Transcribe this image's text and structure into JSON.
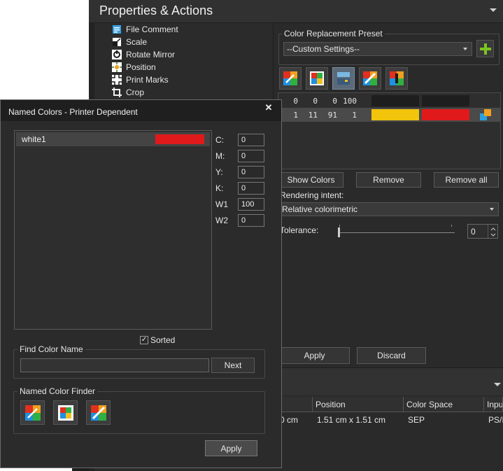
{
  "panel": {
    "title": "Properties & Actions"
  },
  "tree": {
    "items": [
      {
        "label": "File Comment",
        "icon": "file-comment-icon"
      },
      {
        "label": "Scale",
        "icon": "scale-icon"
      },
      {
        "label": "Rotate Mirror",
        "icon": "rotate-mirror-icon"
      },
      {
        "label": "Position",
        "icon": "position-icon"
      },
      {
        "label": "Print Marks",
        "icon": "print-marks-icon"
      },
      {
        "label": "Crop",
        "icon": "crop-icon"
      }
    ]
  },
  "color_replacement": {
    "group_title": "Color Replacement Preset",
    "preset_value": "--Custom Settings--",
    "add_icon": "plus-icon",
    "tools": [
      "picker-edit-icon",
      "color-grid-icon",
      "layout-icon",
      "ruler-color-icon",
      "info-color-icon"
    ],
    "rows": [
      {
        "c": "0",
        "m": "0",
        "y": "0",
        "k": "100",
        "from_color": "#1e1e1e",
        "to_color": "#1e1e1e"
      },
      {
        "c": "1",
        "m": "11",
        "y": "91",
        "k": "1",
        "from_color": "#f2c40c",
        "to_color": "#e01a1a"
      }
    ],
    "show_colors_label": "Show Colors",
    "remove_label": "Remove",
    "remove_all_label": "Remove all",
    "rendering_intent_label": "Rendering intent:",
    "rendering_intent_value": "Relative colorimetric",
    "tolerance_label": "Tolerance:",
    "tolerance_value": "0",
    "apply_label": "Apply",
    "discard_label": "Discard"
  },
  "info_table": {
    "columns": [
      "Position",
      "Color Space",
      "Inpu"
    ],
    "row": {
      "first": "0 cm",
      "position": "1.51 cm x 1.51 cm",
      "color_space": "SEP",
      "input": "PS/I"
    }
  },
  "dialog": {
    "title": "Named Colors - Printer Dependent",
    "close_icon": "close-icon",
    "list_items": [
      {
        "name": "white1",
        "swatch": "#e01a1a"
      }
    ],
    "fields": [
      {
        "label": "C:",
        "value": "0"
      },
      {
        "label": "M:",
        "value": "0"
      },
      {
        "label": "Y:",
        "value": "0"
      },
      {
        "label": "K:",
        "value": "0"
      },
      {
        "label": "W1",
        "value": "100"
      },
      {
        "label": "W2",
        "value": "0"
      }
    ],
    "sorted_label": "Sorted",
    "sorted_checked": true,
    "find_title": "Find Color Name",
    "find_value": "",
    "next_label": "Next",
    "finder_title": "Named Color Finder",
    "finder_tools": [
      "picker-edit-icon",
      "color-grid-icon",
      "ruler-color-icon"
    ],
    "apply_label": "Apply"
  }
}
